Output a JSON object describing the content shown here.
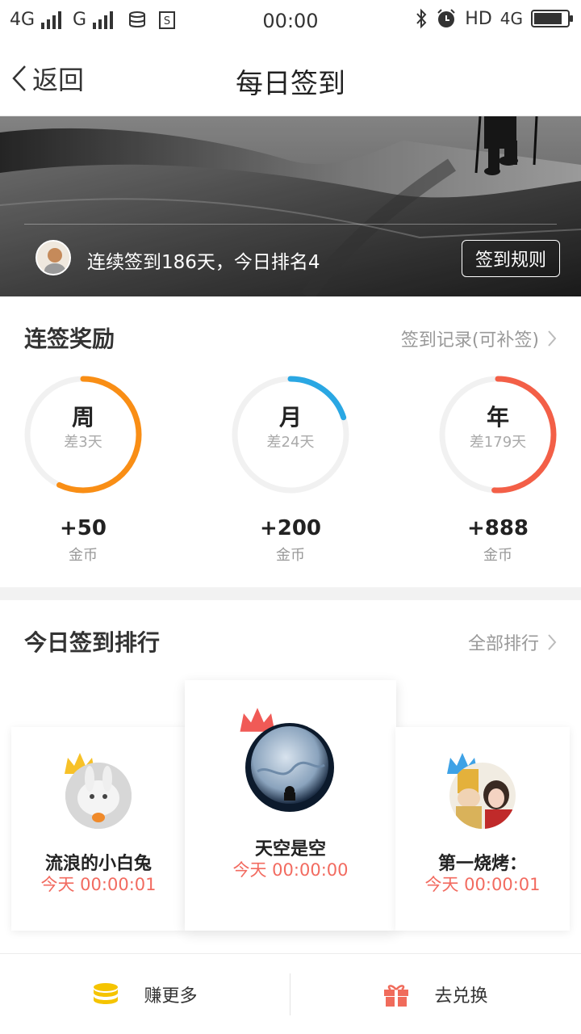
{
  "status_bar": {
    "network_1": "4G",
    "network_2": "G",
    "time": "00:00",
    "hd": "HD",
    "network_3": "4G"
  },
  "nav": {
    "back_label": "返回",
    "title": "每日签到"
  },
  "hero": {
    "status_text": "连续签到186天，今日排名4",
    "rules_button": "签到规则"
  },
  "streak": {
    "title": "连签奖励",
    "record_link": "签到记录(可补签)",
    "items": [
      {
        "label": "周",
        "remaining": "差3天",
        "reward": "+50",
        "unit": "金币",
        "progress": 0.57,
        "color": "#f98e15"
      },
      {
        "label": "月",
        "remaining": "差24天",
        "reward": "+200",
        "unit": "金币",
        "progress": 0.2,
        "color": "#2aa7e3"
      },
      {
        "label": "年",
        "remaining": "差179天",
        "reward": "+888",
        "unit": "金币",
        "progress": 0.51,
        "color": "#f35f47"
      }
    ]
  },
  "ranking": {
    "title": "今日签到排行",
    "all_link": "全部排行",
    "entries": [
      {
        "name": "流浪的小白兔",
        "time": "今天 00:00:01",
        "crown_color": "#f7c128"
      },
      {
        "name": "天空是空",
        "time": "今天 00:00:00",
        "crown_color": "#f05a56"
      },
      {
        "name": "第一烧烤：",
        "time": "今天 00:00:01",
        "crown_color": "#3ea2e6"
      }
    ]
  },
  "bottom": {
    "earn_more": "赚更多",
    "redeem": "去兑换"
  },
  "colors": {
    "accent_red": "#f26b60",
    "coin_yellow": "#f5c400",
    "gift_red": "#f06b5b"
  }
}
